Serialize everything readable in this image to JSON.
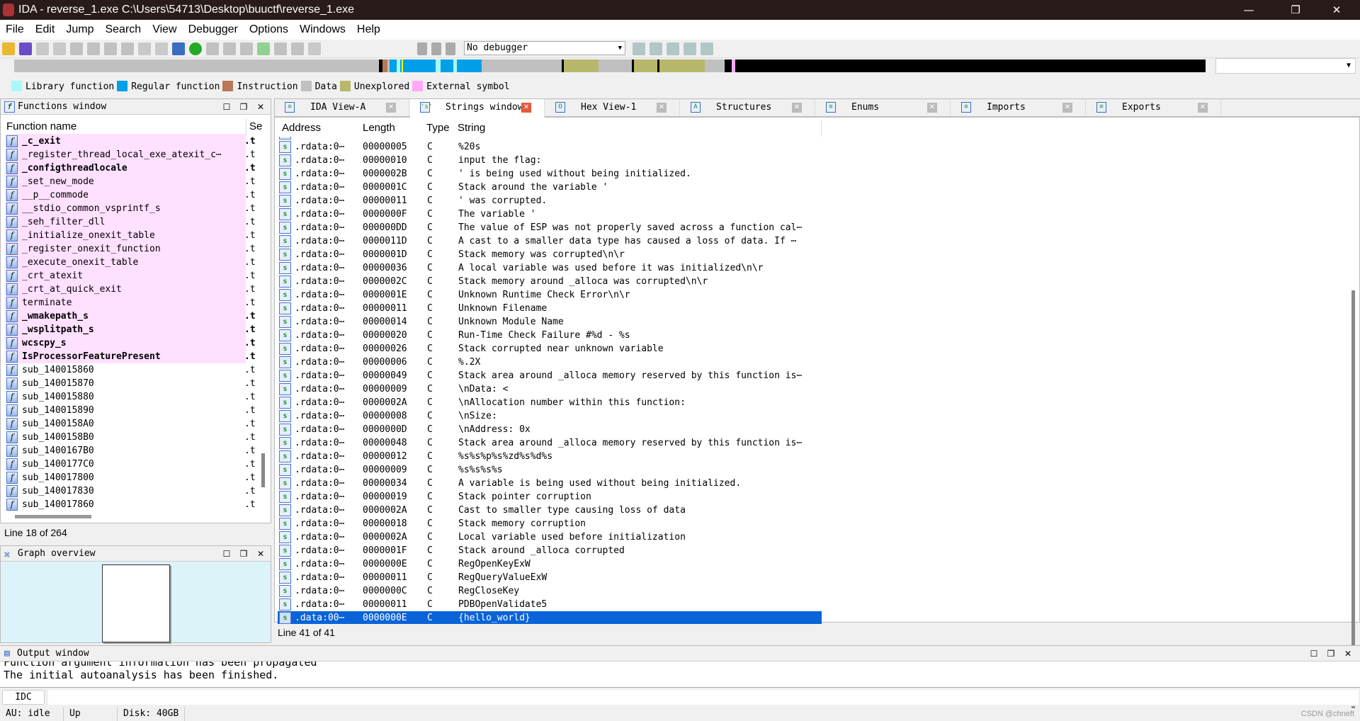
{
  "window": {
    "title": "IDA - reverse_1.exe C:\\Users\\54713\\Desktop\\buuctf\\reverse_1.exe",
    "minimize": "—",
    "restore": "❐",
    "close": "✕"
  },
  "menu": [
    "File",
    "Edit",
    "Jump",
    "Search",
    "View",
    "Debugger",
    "Options",
    "Windows",
    "Help"
  ],
  "toolbar": {
    "debugger_select": "No debugger"
  },
  "colors": {
    "library": "#a8f8f8",
    "regular": "#00a0e8",
    "instruction": "#b8785a",
    "data": "#c0c0c0",
    "unexplored": "#b8b86c",
    "external": "#ffa8f8",
    "selection": "#0a64d8"
  },
  "legend": [
    {
      "label": "Library function",
      "color": "#a8f8f8"
    },
    {
      "label": "Regular function",
      "color": "#00a0e8"
    },
    {
      "label": "Instruction",
      "color": "#b8785a"
    },
    {
      "label": "Data",
      "color": "#c0c0c0"
    },
    {
      "label": "Unexplored",
      "color": "#b8b86c"
    },
    {
      "label": "External symbol",
      "color": "#ffa8f8"
    }
  ],
  "functions": {
    "title": "Functions window",
    "col_name": "Function name",
    "col_seg": "Se",
    "status": "Line 18 of 264",
    "rows": [
      {
        "n": "_c_exit",
        "b": 1,
        "p": 1
      },
      {
        "n": "_register_thread_local_exe_atexit_c⋯",
        "b": 0,
        "p": 1
      },
      {
        "n": "_configthreadlocale",
        "b": 1,
        "p": 1
      },
      {
        "n": "_set_new_mode",
        "b": 0,
        "p": 1
      },
      {
        "n": "__p__commode",
        "b": 0,
        "p": 1
      },
      {
        "n": "__stdio_common_vsprintf_s",
        "b": 0,
        "p": 1
      },
      {
        "n": "_seh_filter_dll",
        "b": 0,
        "p": 1
      },
      {
        "n": "_initialize_onexit_table",
        "b": 0,
        "p": 1
      },
      {
        "n": "_register_onexit_function",
        "b": 0,
        "p": 1
      },
      {
        "n": "_execute_onexit_table",
        "b": 0,
        "p": 1
      },
      {
        "n": "_crt_atexit",
        "b": 0,
        "p": 1
      },
      {
        "n": "_crt_at_quick_exit",
        "b": 0,
        "p": 1
      },
      {
        "n": "terminate",
        "b": 0,
        "p": 1
      },
      {
        "n": "_wmakepath_s",
        "b": 1,
        "p": 1
      },
      {
        "n": "_wsplitpath_s",
        "b": 1,
        "p": 1
      },
      {
        "n": "wcscpy_s",
        "b": 1,
        "p": 1
      },
      {
        "n": "IsProcessorFeaturePresent",
        "b": 1,
        "p": 1
      },
      {
        "n": "sub_140015860",
        "b": 0,
        "p": 0
      },
      {
        "n": "sub_140015870",
        "b": 0,
        "p": 0
      },
      {
        "n": "sub_140015880",
        "b": 0,
        "p": 0
      },
      {
        "n": "sub_140015890",
        "b": 0,
        "p": 0
      },
      {
        "n": "sub_1400158A0",
        "b": 0,
        "p": 0
      },
      {
        "n": "sub_1400158B0",
        "b": 0,
        "p": 0
      },
      {
        "n": "sub_1400167B0",
        "b": 0,
        "p": 0
      },
      {
        "n": "sub_1400177C0",
        "b": 0,
        "p": 0
      },
      {
        "n": "sub_140017800",
        "b": 0,
        "p": 0
      },
      {
        "n": "sub_140017830",
        "b": 0,
        "p": 0
      },
      {
        "n": "sub_140017860",
        "b": 0,
        "p": 0
      }
    ],
    "seg": ".t"
  },
  "graph": {
    "title": "Graph overview"
  },
  "tabs": [
    {
      "label": "IDA View-A",
      "icon": "≡"
    },
    {
      "label": "Strings window",
      "icon": "'s'",
      "active": true
    },
    {
      "label": "Hex View-1",
      "icon": "O"
    },
    {
      "label": "Structures",
      "icon": "A"
    },
    {
      "label": "Enums",
      "icon": "≡"
    },
    {
      "label": "Imports",
      "icon": "≡"
    },
    {
      "label": "Exports",
      "icon": "≡"
    }
  ],
  "strings": {
    "cols": [
      "Address",
      "Length",
      "Type",
      "String"
    ],
    "status": "Line 41 of 41",
    "rows": [
      [
        ".rdata:0⋯",
        "00000005",
        "C",
        "%20s"
      ],
      [
        ".rdata:0⋯",
        "00000010",
        "C",
        "input the flag:"
      ],
      [
        ".rdata:0⋯",
        "0000002B",
        "C",
        "' is being used without being initialized."
      ],
      [
        ".rdata:0⋯",
        "0000001C",
        "C",
        "Stack around the variable '"
      ],
      [
        ".rdata:0⋯",
        "00000011",
        "C",
        "' was corrupted."
      ],
      [
        ".rdata:0⋯",
        "0000000F",
        "C",
        "The variable '"
      ],
      [
        ".rdata:0⋯",
        "000000DD",
        "C",
        "The value of ESP was not properly saved across a function cal⋯"
      ],
      [
        ".rdata:0⋯",
        "0000011D",
        "C",
        "A cast to a smaller data type has caused a loss of data.  If ⋯"
      ],
      [
        ".rdata:0⋯",
        "0000001D",
        "C",
        "Stack memory was corrupted\\n\\r"
      ],
      [
        ".rdata:0⋯",
        "00000036",
        "C",
        "A local variable was used before it was initialized\\n\\r"
      ],
      [
        ".rdata:0⋯",
        "0000002C",
        "C",
        "Stack memory around _alloca was corrupted\\n\\r"
      ],
      [
        ".rdata:0⋯",
        "0000001E",
        "C",
        "Unknown Runtime Check Error\\n\\r"
      ],
      [
        ".rdata:0⋯",
        "00000011",
        "C",
        "Unknown Filename"
      ],
      [
        ".rdata:0⋯",
        "00000014",
        "C",
        "Unknown Module Name"
      ],
      [
        ".rdata:0⋯",
        "00000020",
        "C",
        "Run-Time Check Failure #%d - %s"
      ],
      [
        ".rdata:0⋯",
        "00000026",
        "C",
        "Stack corrupted near unknown variable"
      ],
      [
        ".rdata:0⋯",
        "00000006",
        "C",
        "%.2X"
      ],
      [
        ".rdata:0⋯",
        "00000049",
        "C",
        "Stack area around _alloca memory reserved by this function is⋯"
      ],
      [
        ".rdata:0⋯",
        "00000009",
        "C",
        "\\nData: <"
      ],
      [
        ".rdata:0⋯",
        "0000002A",
        "C",
        "\\nAllocation number within this function:"
      ],
      [
        ".rdata:0⋯",
        "00000008",
        "C",
        "\\nSize:"
      ],
      [
        ".rdata:0⋯",
        "0000000D",
        "C",
        "\\nAddress: 0x"
      ],
      [
        ".rdata:0⋯",
        "00000048",
        "C",
        "Stack area around _alloca memory reserved by this function is⋯"
      ],
      [
        ".rdata:0⋯",
        "00000012",
        "C",
        "%s%s%p%s%zd%s%d%s"
      ],
      [
        ".rdata:0⋯",
        "00000009",
        "C",
        "%s%s%s%s"
      ],
      [
        ".rdata:0⋯",
        "00000034",
        "C",
        "A variable is being used without being initialized."
      ],
      [
        ".rdata:0⋯",
        "00000019",
        "C",
        "Stack pointer corruption"
      ],
      [
        ".rdata:0⋯",
        "0000002A",
        "C",
        "Cast to smaller type causing loss of data"
      ],
      [
        ".rdata:0⋯",
        "00000018",
        "C",
        "Stack memory corruption"
      ],
      [
        ".rdata:0⋯",
        "0000002A",
        "C",
        "Local variable used before initialization"
      ],
      [
        ".rdata:0⋯",
        "0000001F",
        "C",
        "Stack around _alloca corrupted"
      ],
      [
        ".rdata:0⋯",
        "0000000E",
        "C",
        "RegOpenKeyExW"
      ],
      [
        ".rdata:0⋯",
        "00000011",
        "C",
        "RegQueryValueExW"
      ],
      [
        ".rdata:0⋯",
        "0000000C",
        "C",
        "RegCloseKey"
      ],
      [
        ".rdata:0⋯",
        "00000011",
        "C",
        "PDBOpenValidate5"
      ],
      [
        ".data:00⋯",
        "0000000E",
        "C",
        "{hello_world}"
      ]
    ],
    "selected_index": 35
  },
  "output": {
    "title": "Output window",
    "lines": [
      "Function argument information has been propagated",
      "The initial autoanalysis has been finished."
    ],
    "idc_button": "IDC"
  },
  "status": {
    "au": "AU:  idle",
    "dir": "Up",
    "disk": "Disk: 40GB"
  },
  "watermark": "CSDN @chneft"
}
